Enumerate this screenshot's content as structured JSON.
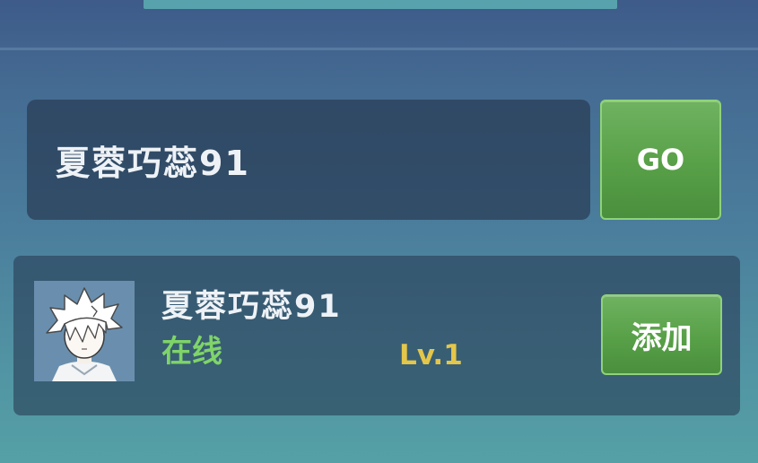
{
  "search": {
    "value": "夏蓉巧蕊91",
    "go_label": "GO"
  },
  "result": {
    "name": "夏蓉巧蕊91",
    "status": "在线",
    "level": "Lv.1",
    "add_label": "添加"
  },
  "colors": {
    "online": "#7fd468",
    "level": "#e4c64a",
    "button_green": "#58a048"
  }
}
